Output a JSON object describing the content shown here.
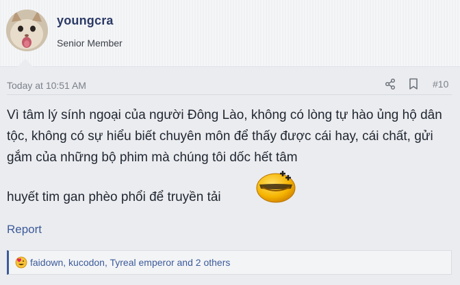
{
  "user": {
    "name": "youngcra",
    "title": "Senior Member"
  },
  "post": {
    "date": "Today at 10:51 AM",
    "number": "#10",
    "body_line1": "Vì tâm lý sính ngoại của người Đông Lào, không có lòng tự hào ủng hộ dân tộc, không có sự hiểu biết chuyên môn để thấy được cái hay, cái chất, gửi gắm của những bộ phim mà chúng tôi dốc hết tâm",
    "body_line2": "huyết tim gan phèo phổi để truyền tải",
    "report_label": "Report"
  },
  "reactions": {
    "text": "faidown, kucodon, Tyreal emperor and 2 others"
  },
  "icons": {
    "share": "share-icon",
    "bookmark": "bookmark-icon",
    "smiley": "grinning-smiley-icon",
    "reaction": "love-reaction-icon"
  },
  "colors": {
    "accent": "#3b5a9a",
    "username": "#2b3a66",
    "post_background": "#ebecef"
  }
}
